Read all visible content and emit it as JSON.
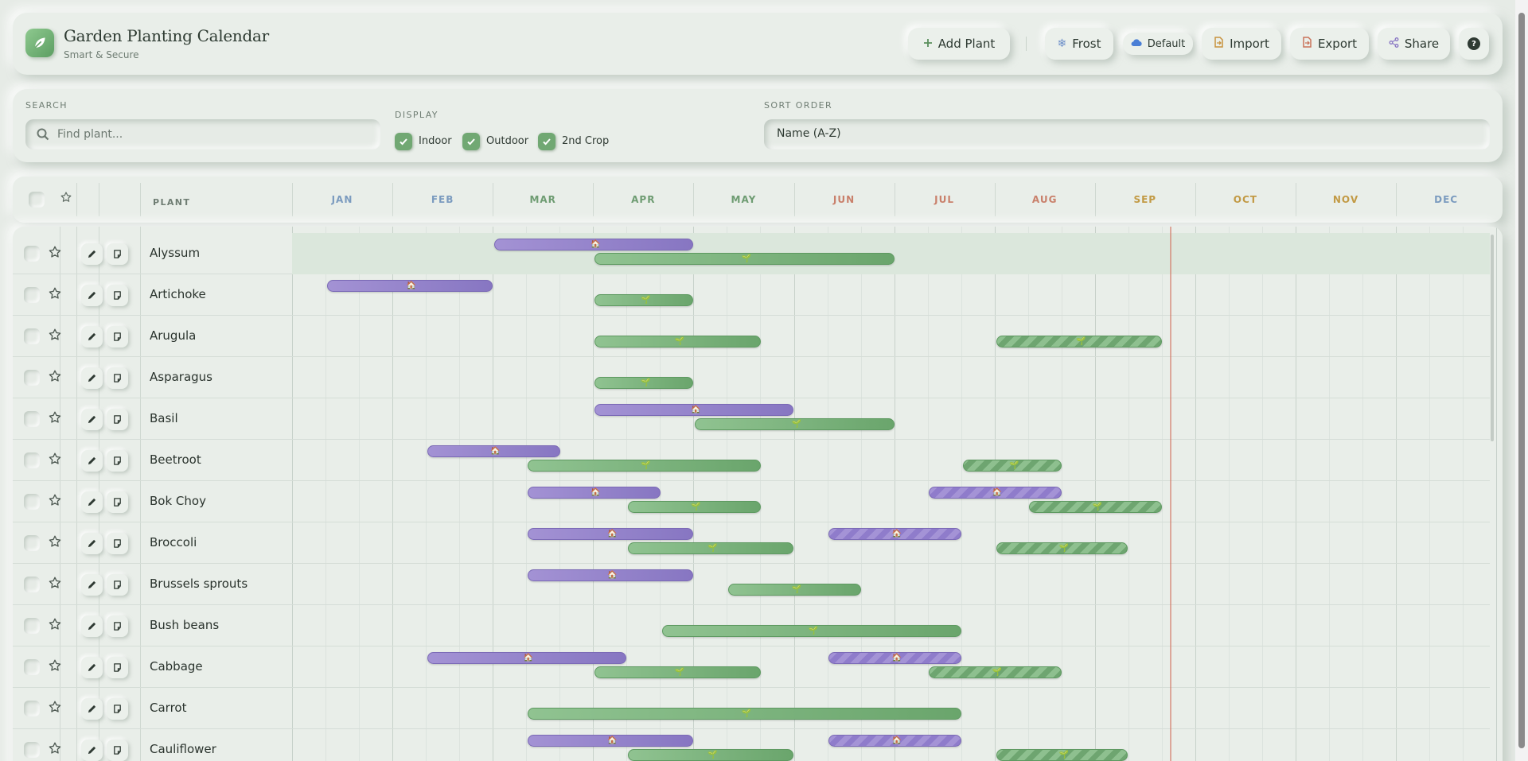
{
  "app": {
    "title": "Garden Planting Calendar",
    "subtitle": "Smart & Secure"
  },
  "header": {
    "add_plant": "Add Plant",
    "frost": "Frost",
    "profile": "Default",
    "import": "Import",
    "export": "Export",
    "share": "Share",
    "help": "?"
  },
  "filters": {
    "search_label": "SEARCH",
    "search_placeholder": "Find plant...",
    "search_value": "",
    "display_label": "DISPLAY",
    "display_options": [
      {
        "label": "Indoor",
        "checked": true
      },
      {
        "label": "Outdoor",
        "checked": true
      },
      {
        "label": "2nd Crop",
        "checked": true
      }
    ],
    "sort_label": "SORT ORDER",
    "sort_value": "Name (A-Z)"
  },
  "grid": {
    "plant_header": "PLANT",
    "months": [
      "JAN",
      "FEB",
      "MAR",
      "APR",
      "MAY",
      "JUN",
      "JUL",
      "AUG",
      "SEP",
      "OCT",
      "NOV",
      "DEC"
    ],
    "month_colors": [
      "#7b9bbf",
      "#7b9bbf",
      "#6e9c72",
      "#6e9c72",
      "#6e9c72",
      "#c9806b",
      "#c9806b",
      "#c9806b",
      "#c29a45",
      "#c29a45",
      "#c29a45",
      "#7b9bbf"
    ],
    "today_month": 8.75,
    "rows": [
      {
        "name": "Alyssum",
        "highlighted": true,
        "bars": [
          {
            "type": "indoor",
            "start": 3.0,
            "end": 5.0,
            "lane": 0
          },
          {
            "type": "outdoor",
            "start": 4.0,
            "end": 7.0,
            "lane": 1
          }
        ]
      },
      {
        "name": "Artichoke",
        "bars": [
          {
            "type": "indoor",
            "start": 1.33,
            "end": 3.0,
            "lane": 0
          },
          {
            "type": "outdoor",
            "start": 4.0,
            "end": 5.0,
            "lane": 1
          }
        ]
      },
      {
        "name": "Arugula",
        "bars": [
          {
            "type": "outdoor",
            "start": 4.0,
            "end": 5.67,
            "lane": 1
          },
          {
            "type": "second-out",
            "start": 8.0,
            "end": 9.67,
            "lane": 1
          }
        ]
      },
      {
        "name": "Asparagus",
        "bars": [
          {
            "type": "outdoor",
            "start": 4.0,
            "end": 5.0,
            "lane": 1
          }
        ]
      },
      {
        "name": "Basil",
        "bars": [
          {
            "type": "indoor",
            "start": 4.0,
            "end": 6.0,
            "lane": 0
          },
          {
            "type": "outdoor",
            "start": 5.0,
            "end": 7.0,
            "lane": 1
          }
        ]
      },
      {
        "name": "Beetroot",
        "bars": [
          {
            "type": "indoor",
            "start": 2.33,
            "end": 3.67,
            "lane": 0
          },
          {
            "type": "outdoor",
            "start": 3.33,
            "end": 5.67,
            "lane": 1
          },
          {
            "type": "second-out",
            "start": 7.67,
            "end": 8.67,
            "lane": 1
          }
        ]
      },
      {
        "name": "Bok Choy",
        "bars": [
          {
            "type": "indoor",
            "start": 3.33,
            "end": 4.67,
            "lane": 0
          },
          {
            "type": "outdoor",
            "start": 4.33,
            "end": 5.67,
            "lane": 1
          },
          {
            "type": "second-in",
            "start": 7.33,
            "end": 8.67,
            "lane": 0
          },
          {
            "type": "second-out",
            "start": 8.33,
            "end": 9.67,
            "lane": 1
          }
        ]
      },
      {
        "name": "Broccoli",
        "bars": [
          {
            "type": "indoor",
            "start": 3.33,
            "end": 5.0,
            "lane": 0
          },
          {
            "type": "outdoor",
            "start": 4.33,
            "end": 6.0,
            "lane": 1
          },
          {
            "type": "second-in",
            "start": 6.33,
            "end": 7.67,
            "lane": 0
          },
          {
            "type": "second-out",
            "start": 8.0,
            "end": 9.33,
            "lane": 1
          }
        ]
      },
      {
        "name": "Brussels sprouts",
        "bars": [
          {
            "type": "indoor",
            "start": 3.33,
            "end": 5.0,
            "lane": 0
          },
          {
            "type": "outdoor",
            "start": 5.33,
            "end": 6.67,
            "lane": 1
          }
        ]
      },
      {
        "name": "Bush beans",
        "bars": [
          {
            "type": "outdoor",
            "start": 4.67,
            "end": 7.67,
            "lane": 1
          }
        ]
      },
      {
        "name": "Cabbage",
        "bars": [
          {
            "type": "indoor",
            "start": 2.33,
            "end": 4.33,
            "lane": 0
          },
          {
            "type": "outdoor",
            "start": 4.0,
            "end": 5.67,
            "lane": 1
          },
          {
            "type": "second-in",
            "start": 6.33,
            "end": 7.67,
            "lane": 0
          },
          {
            "type": "second-out",
            "start": 7.33,
            "end": 8.67,
            "lane": 1
          }
        ]
      },
      {
        "name": "Carrot",
        "bars": [
          {
            "type": "outdoor",
            "start": 3.33,
            "end": 7.67,
            "lane": 1
          }
        ]
      },
      {
        "name": "Cauliflower",
        "bars": [
          {
            "type": "indoor",
            "start": 3.33,
            "end": 5.0,
            "lane": 0
          },
          {
            "type": "outdoor",
            "start": 4.33,
            "end": 6.0,
            "lane": 1
          },
          {
            "type": "second-in",
            "start": 6.33,
            "end": 7.67,
            "lane": 0
          },
          {
            "type": "second-out",
            "start": 8.0,
            "end": 9.33,
            "lane": 1
          }
        ]
      }
    ]
  }
}
